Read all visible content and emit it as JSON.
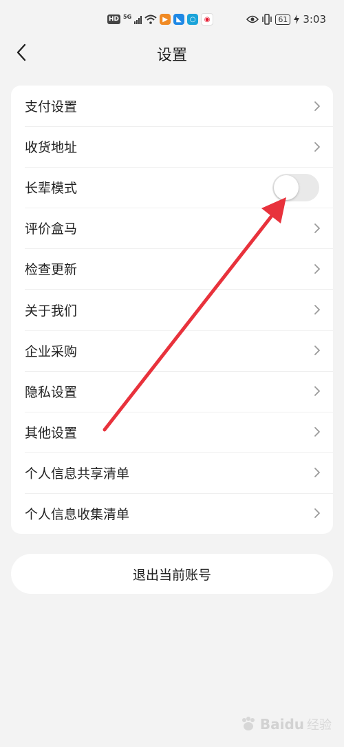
{
  "status_bar": {
    "hd": "HD",
    "network": "5G",
    "battery": "61",
    "time": "3:03",
    "icons": [
      "hd-icon",
      "signal-icon",
      "wifi-icon",
      "app-video-icon",
      "app-direct-icon",
      "app-search-icon",
      "app-weibo-icon",
      "eye-icon",
      "vibrate-icon",
      "battery-icon",
      "charging-icon"
    ]
  },
  "header": {
    "title": "设置",
    "back_icon": "chevron-left-icon"
  },
  "settings": {
    "items": [
      {
        "label": "支付设置",
        "control": "chevron"
      },
      {
        "label": "收货地址",
        "control": "chevron"
      },
      {
        "label": "长辈模式",
        "control": "toggle",
        "toggle_on": false
      },
      {
        "label": "评价盒马",
        "control": "chevron"
      },
      {
        "label": "检查更新",
        "control": "chevron"
      },
      {
        "label": "关于我们",
        "control": "chevron"
      },
      {
        "label": "企业采购",
        "control": "chevron"
      },
      {
        "label": "隐私设置",
        "control": "chevron"
      },
      {
        "label": "其他设置",
        "control": "chevron"
      },
      {
        "label": "个人信息共享清单",
        "control": "chevron"
      },
      {
        "label": "个人信息收集清单",
        "control": "chevron"
      }
    ]
  },
  "logout": {
    "label": "退出当前账号"
  },
  "colors": {
    "background": "#f3f3f3",
    "card": "#ffffff",
    "toggle_off": "#e9e9e9",
    "annotation_arrow": "#e8323c"
  },
  "watermark": {
    "brand": "Baidu",
    "sub": "经验"
  }
}
